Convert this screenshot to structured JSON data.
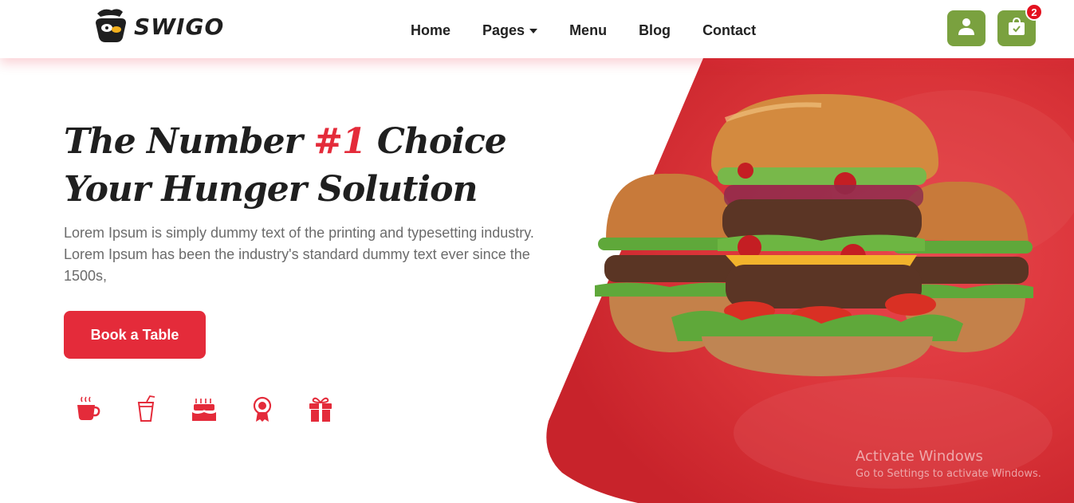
{
  "brand": {
    "name": "SWIGO",
    "logo_icon": "chef-hat-logo-icon"
  },
  "nav": {
    "items": [
      {
        "label": "Home"
      },
      {
        "label": "Pages",
        "has_dropdown": true
      },
      {
        "label": "Menu"
      },
      {
        "label": "Blog"
      },
      {
        "label": "Contact"
      }
    ]
  },
  "header_actions": {
    "user_icon": "user-icon",
    "cart_icon": "shopping-bag-icon",
    "cart_count": "2",
    "accent_color": "#7aa13f",
    "badge_color": "#e3121f"
  },
  "hero": {
    "title_part1": "The Number ",
    "title_accent": "#1",
    "title_part2": " Choice Your Hunger Solution",
    "description": "Lorem Ipsum is simply dummy text of the printing and typesetting industry. Lorem Ipsum has been the industry's standard dummy text ever since the 1500s,",
    "cta_label": "Book a Table",
    "accent_color": "#e42b3a",
    "feature_icons": [
      "coffee-cup-icon",
      "drink-cup-icon",
      "birthday-cake-icon",
      "award-badge-icon",
      "gift-box-icon"
    ]
  },
  "watermark": {
    "title": "Activate Windows",
    "subtitle": "Go to Settings to activate Windows."
  }
}
